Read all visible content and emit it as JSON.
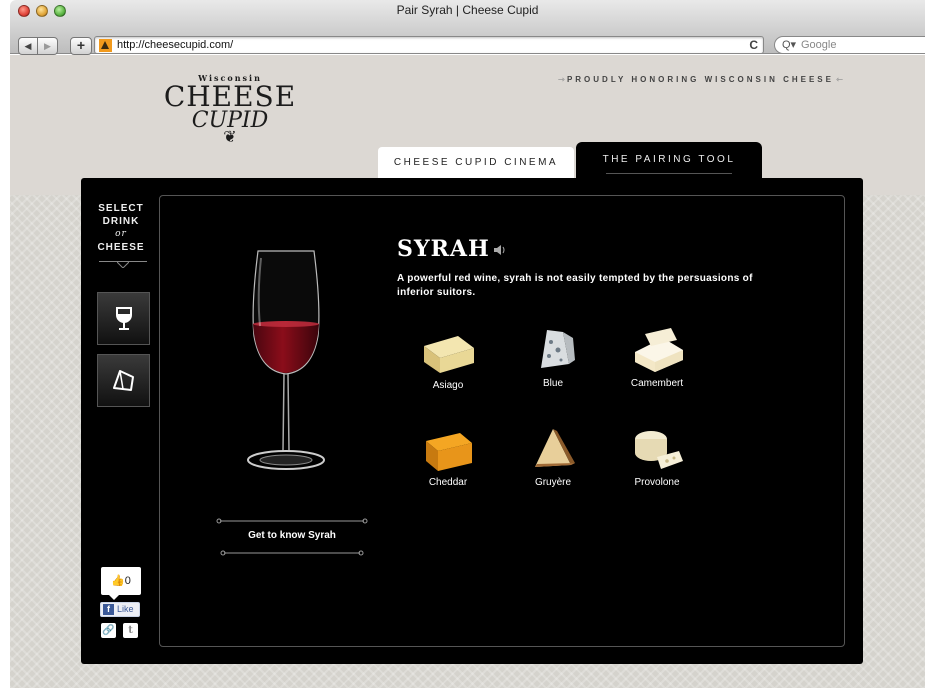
{
  "browser": {
    "window_title": "Pair Syrah | Cheese Cupid",
    "url": "http://cheesecupid.com/",
    "search_placeholder": "Google",
    "add_label": "+",
    "reload_label": "C"
  },
  "site": {
    "logo_top": "Wisconsin",
    "logo_main": "CHEESE",
    "logo_sub": "CUPID",
    "tagline": "PROUDLY HONORING WISCONSIN CHEESE",
    "tabs": [
      {
        "label": "CHEESE CUPID CINEMA",
        "active": false
      },
      {
        "label": "THE PAIRING TOOL",
        "active": true
      }
    ]
  },
  "sidebar": {
    "heading_line1": "SELECT",
    "heading_line2": "DRINK",
    "heading_or": "or",
    "heading_line3": "CHEESE",
    "buttons": [
      {
        "label": "drink",
        "icon": "wine-glass-icon"
      },
      {
        "label": "cheese",
        "icon": "cheese-wedge-icon"
      }
    ],
    "like_count": "0",
    "fb_like_label": "Like"
  },
  "wine": {
    "name": "SYRAH",
    "description": "A powerful red wine, syrah is not easily tempted by the persuasions of inferior suitors.",
    "cta": "Get to know Syrah",
    "color": "#8b0d1a"
  },
  "cheeses": [
    {
      "name": "Asiago"
    },
    {
      "name": "Blue"
    },
    {
      "name": "Camembert"
    },
    {
      "name": "Cheddar"
    },
    {
      "name": "Gruyère"
    },
    {
      "name": "Provolone"
    }
  ],
  "colors": {
    "panel": "#000000",
    "page_bg": "#dcd8d3"
  }
}
